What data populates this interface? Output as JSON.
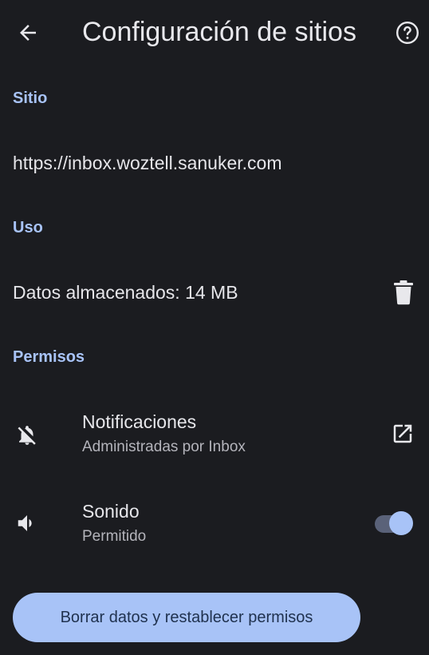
{
  "header": {
    "title": "Configuración de sitios",
    "back_icon": "arrow-back-icon",
    "help_icon": "help-circle-icon"
  },
  "site_section": {
    "header": "Sitio",
    "url": "https://inbox.woztell.sanuker.com"
  },
  "usage_section": {
    "header": "Uso",
    "stored_data": "Datos almacenados: 14 MB",
    "delete_icon": "trash-icon"
  },
  "permissions_section": {
    "header": "Permisos",
    "items": [
      {
        "title": "Notificaciones",
        "subtitle": "Administradas por Inbox",
        "icon": "notifications-off-icon",
        "action_icon": "open-in-new-icon"
      },
      {
        "title": "Sonido",
        "subtitle": "Permitido",
        "icon": "volume-icon",
        "toggle_on": true
      }
    ]
  },
  "reset_button": {
    "label": "Borrar datos y restablecer permisos"
  },
  "colors": {
    "background": "#1b1c20",
    "accent": "#a8c3f7",
    "text_primary": "#e6e6ea",
    "text_secondary": "#b4b4bb"
  }
}
